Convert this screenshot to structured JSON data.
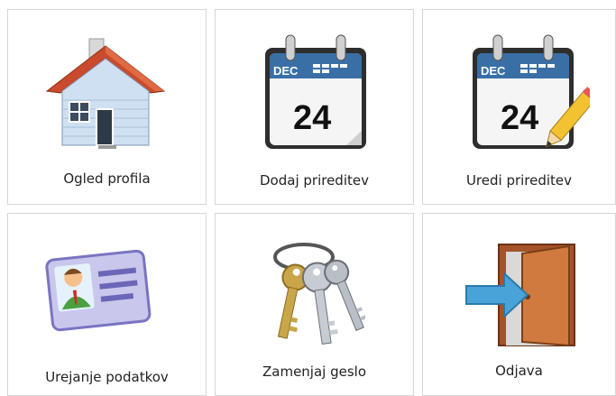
{
  "tiles": [
    {
      "label": "Ogled profila",
      "icon": "house-icon"
    },
    {
      "label": "Dodaj prireditev",
      "icon": "calendar-icon"
    },
    {
      "label": "Uredi prireditev",
      "icon": "calendar-edit-icon"
    },
    {
      "label": "Urejanje podatkov",
      "icon": "id-card-icon"
    },
    {
      "label": "Zamenjaj geslo",
      "icon": "keys-icon"
    },
    {
      "label": "Odjava",
      "icon": "exit-door-icon"
    }
  ],
  "calendar": {
    "month": "DEC",
    "day": "24"
  },
  "colors": {
    "border": "#d6d6d6",
    "text": "#222222",
    "calendar_blue": "#3a6fa6",
    "door": "#c6703a",
    "arrow": "#4aa3d8"
  }
}
